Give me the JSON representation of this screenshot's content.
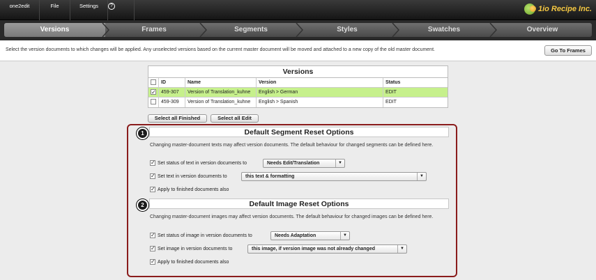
{
  "topbar": {
    "menu": [
      {
        "label": "one2edit"
      },
      {
        "label": "File"
      },
      {
        "label": "Settings"
      }
    ],
    "help_glyph": "?",
    "brand": "1io Recipe Inc."
  },
  "steps": [
    {
      "label": "Versions",
      "active": true
    },
    {
      "label": "Frames",
      "active": false
    },
    {
      "label": "Segments",
      "active": false
    },
    {
      "label": "Styles",
      "active": false
    },
    {
      "label": "Swatches",
      "active": false
    },
    {
      "label": "Overview",
      "active": false
    }
  ],
  "instruction": {
    "text": "Select the version documents to which changes will be applied. Any unselected versions based on the current master document will be moved and attached to a new copy of the old master document.",
    "go_button": "Go To Frames"
  },
  "versions_table": {
    "title": "Versions",
    "columns": [
      "ID",
      "Name",
      "Version",
      "Status"
    ],
    "rows": [
      {
        "checked": true,
        "id": "459-307",
        "name": "Version of Translation_kuhne",
        "version": "English > German",
        "status": "EDIT",
        "selected": true
      },
      {
        "checked": false,
        "id": "459-309",
        "name": "Version of Translation_kuhne",
        "version": "English > Spanish",
        "status": "EDIT",
        "selected": false
      }
    ],
    "select_finished": "Select all Finished",
    "select_edit": "Select all Edit"
  },
  "segment_options": {
    "badge": "1",
    "title": "Default Segment Reset Options",
    "description": "Changing master-document texts may affect version documents. The default behaviour for changed segments can be defined here.",
    "status_label": "Set status of text in version documents to",
    "status_value": "Needs Edit/Translation",
    "text_label": "Set text in version documents to",
    "text_value": "this text & formatting",
    "apply_label": "Apply to finished documents also"
  },
  "image_options": {
    "badge": "2",
    "title": "Default Image Reset Options",
    "description": "Changing master-document images may affect version documents. The default behaviour for changed images can be defined here.",
    "status_label": "Set status of image in version documents to",
    "status_value": "Needs Adaptation",
    "image_label": "Set image in version documents to",
    "image_value": "this image, if version image was not already changed",
    "apply_label": "Apply to finished documents also"
  },
  "colors": {
    "accent_border": "#8a1c1c",
    "selected_row": "#c6f08c",
    "brand": "#f5c842"
  },
  "icons": {
    "checkbox_checked": "check-icon",
    "dropdown": "chevron-down-icon",
    "help": "help-icon"
  }
}
